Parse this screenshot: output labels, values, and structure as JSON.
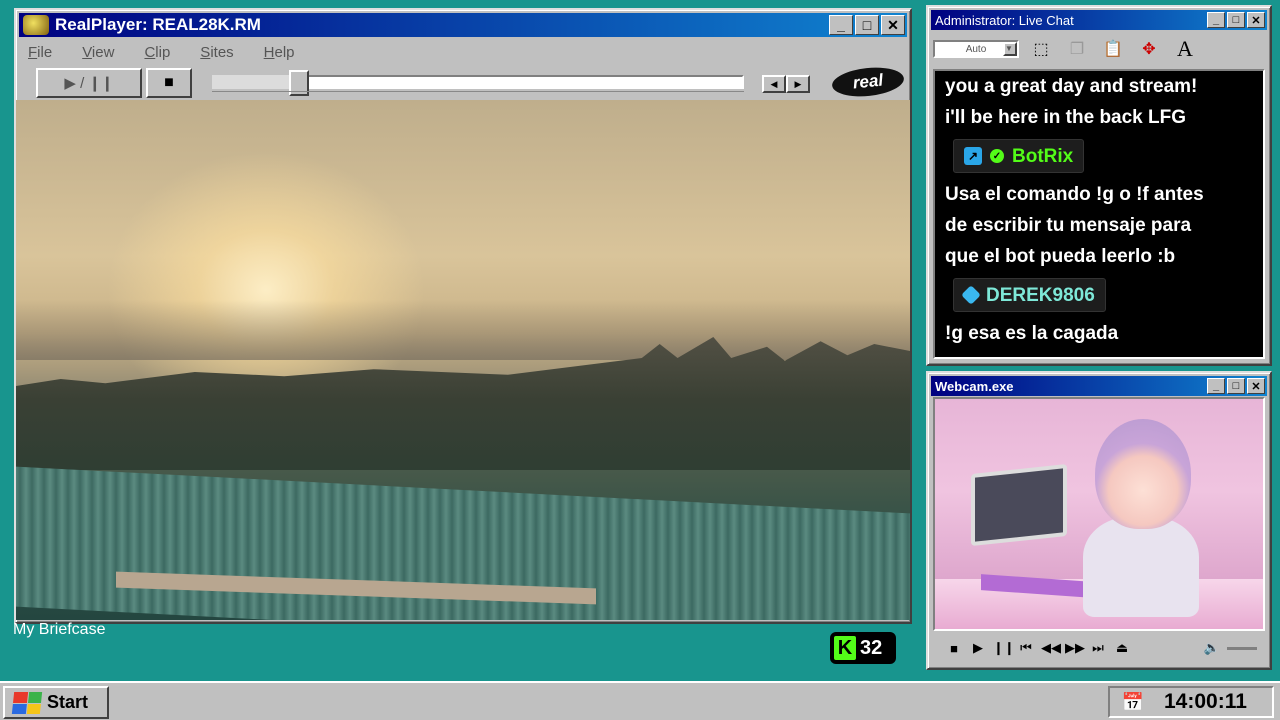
{
  "realplayer": {
    "title": "RealPlayer: REAL28K.RM",
    "menu": [
      "File",
      "View",
      "Clip",
      "Sites",
      "Help"
    ],
    "play_pause_label": "▶ / ❙❙",
    "stop_label": "■",
    "logo_text": "real",
    "seek_progress_fraction": 0.15
  },
  "chat": {
    "title": "Administrator: Live Chat",
    "font_size_select": "Auto",
    "intro_lines": [
      "you a great day and stream!",
      "i'll be here in the back LFG"
    ],
    "messages": [
      {
        "username": "BotRix",
        "username_color": "#53fc18",
        "text_lines": [
          "Usa el comando !g o !f antes",
          "de escribir tu mensaje para",
          "que el bot pueda leerlo :b"
        ]
      },
      {
        "username": "DEREK9806",
        "username_color": "#7ee8d8",
        "text_lines": [
          "!g esa es la cagada"
        ]
      }
    ]
  },
  "webcam": {
    "title": "Webcam.exe"
  },
  "desktop": {
    "briefcase_label": "My Briefcase",
    "viewer_count": "32"
  },
  "taskbar": {
    "start_label": "Start",
    "clock": "14:00:11"
  },
  "colors": {
    "desktop_bg": "#18958e",
    "title_active": "#000080",
    "kick_green": "#53fc18"
  }
}
